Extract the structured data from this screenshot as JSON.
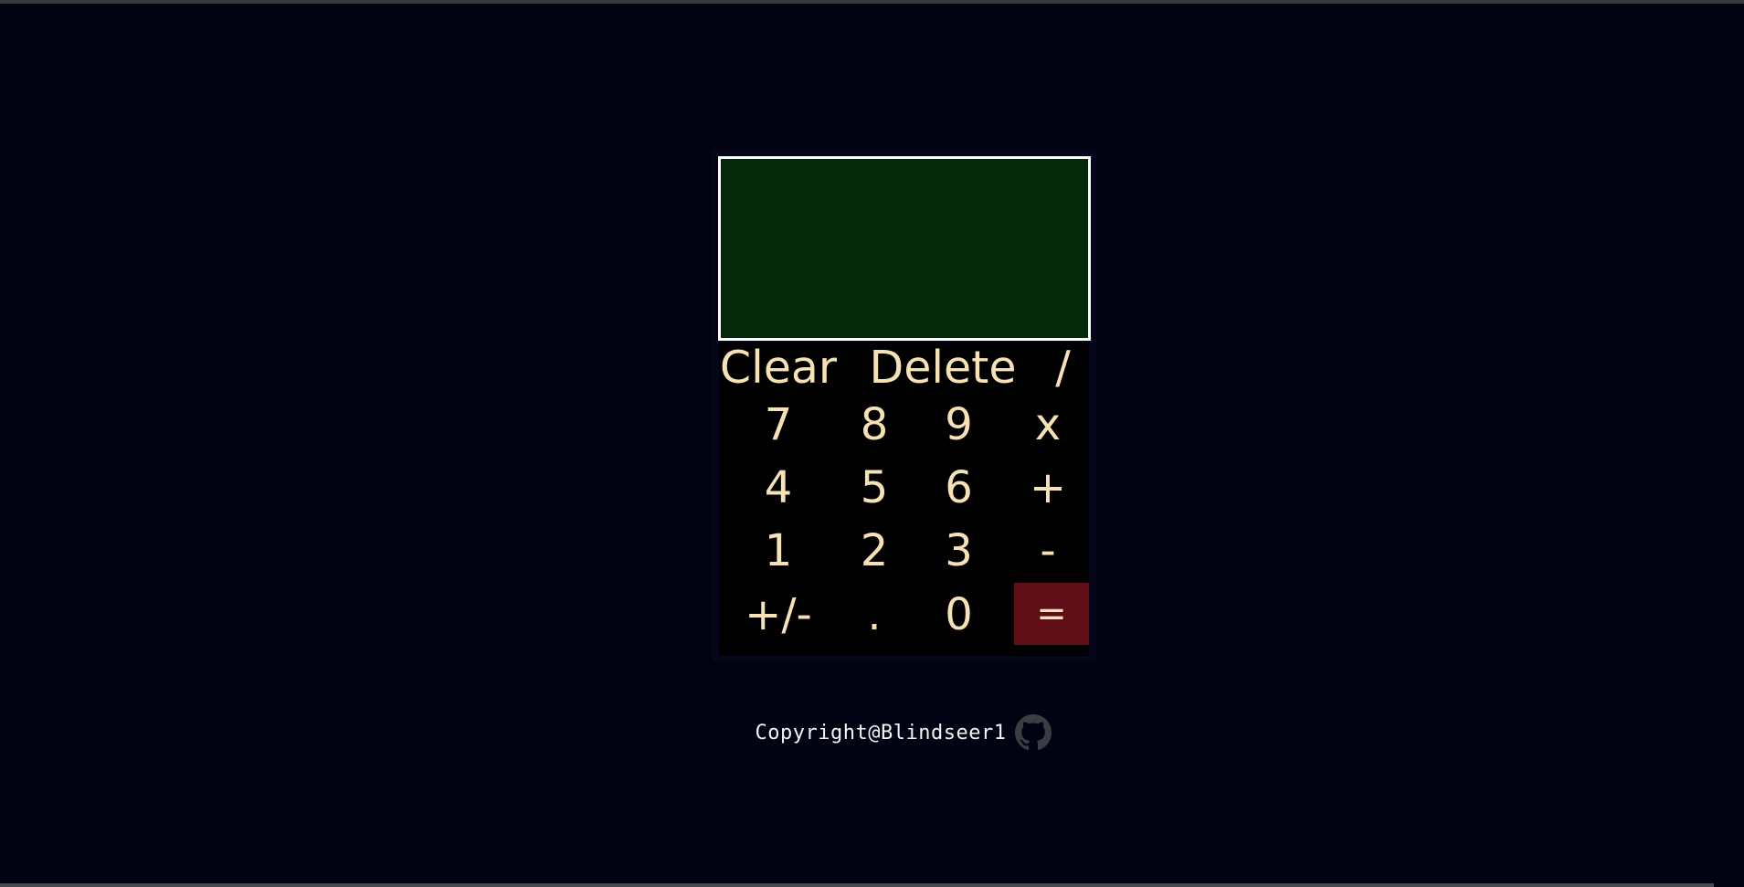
{
  "calculator": {
    "display_value": "",
    "row1": [
      "Clear",
      "Delete",
      "/"
    ],
    "row2": [
      "7",
      "8",
      "9",
      "x"
    ],
    "row3": [
      "4",
      "5",
      "6",
      "+"
    ],
    "row4": [
      "1",
      "2",
      "3",
      "-"
    ],
    "row5": [
      "+/-",
      ".",
      "0",
      "="
    ]
  },
  "footer": {
    "text": "Copyright@Blindseer1",
    "icon": "github-icon"
  },
  "colors": {
    "page_background": "#020312",
    "display_background": "#03290a",
    "key_text": "#f6e2b5",
    "equals_background": "#5f0d17"
  }
}
